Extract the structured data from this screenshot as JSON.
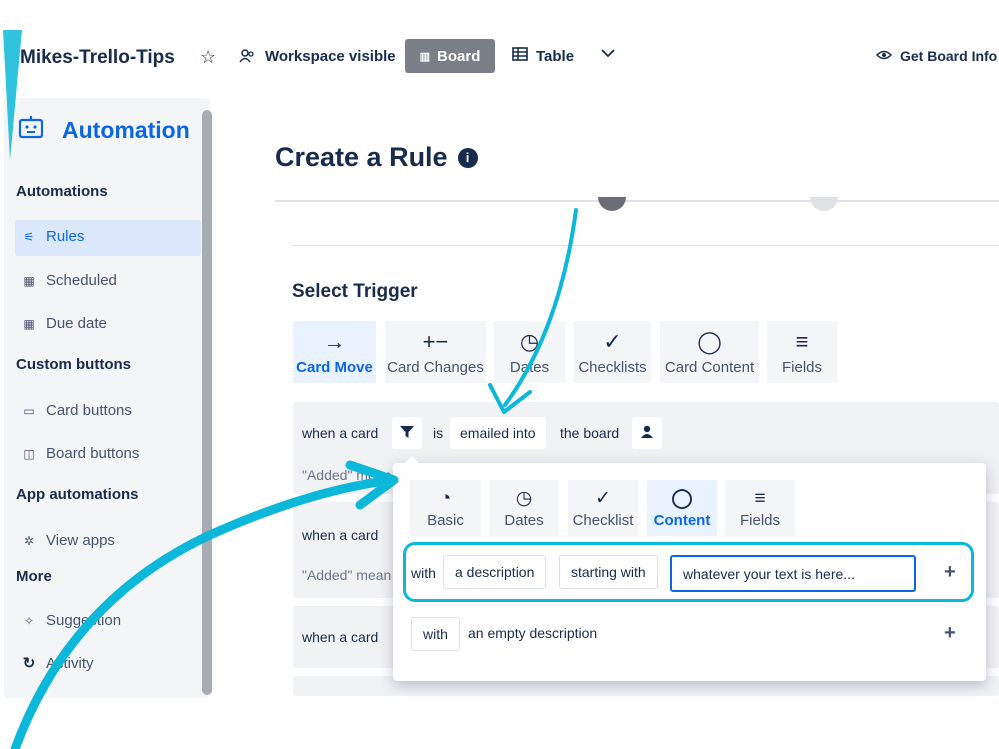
{
  "header": {
    "board_title": "Mikes-Trello-Tips",
    "visibility": "Workspace visible",
    "board_view": "Board",
    "table_view": "Table",
    "get_info": "Get Board Info"
  },
  "sidebar": {
    "title": "Automation",
    "sections": {
      "automations": "Automations",
      "custom_buttons": "Custom buttons",
      "app_automations": "App automations",
      "more": "More"
    },
    "items": {
      "rules": "Rules",
      "scheduled": "Scheduled",
      "due_date": "Due date",
      "card_buttons": "Card buttons",
      "board_buttons": "Board buttons",
      "view_apps": "View apps",
      "suggestions": "Suggestion",
      "activity": "Activity"
    }
  },
  "main": {
    "title": "Create a Rule",
    "select_trigger": "Select Trigger",
    "tabs": [
      "Card Move",
      "Card Changes",
      "Dates",
      "Checklists",
      "Card Content",
      "Fields"
    ],
    "trigger1": {
      "when": "when a card",
      "is": "is",
      "action": "emailed into",
      "target": "the board",
      "note": "\"Added\" mean"
    },
    "trigger2": {
      "when": "when a card",
      "note": "\"Added\" mean"
    },
    "trigger3": {
      "when": "when a card"
    }
  },
  "popup": {
    "tabs": [
      "Basic",
      "Dates",
      "Checklist",
      "Content",
      "Fields"
    ],
    "row1": {
      "with": "with",
      "subject": "a description",
      "operator": "starting with",
      "value": "whatever your text is here..."
    },
    "row2": {
      "with": "with",
      "subject": "an empty description"
    }
  },
  "colors": {
    "accent": "#0c66e4",
    "highlight": "#0bb8d9"
  }
}
